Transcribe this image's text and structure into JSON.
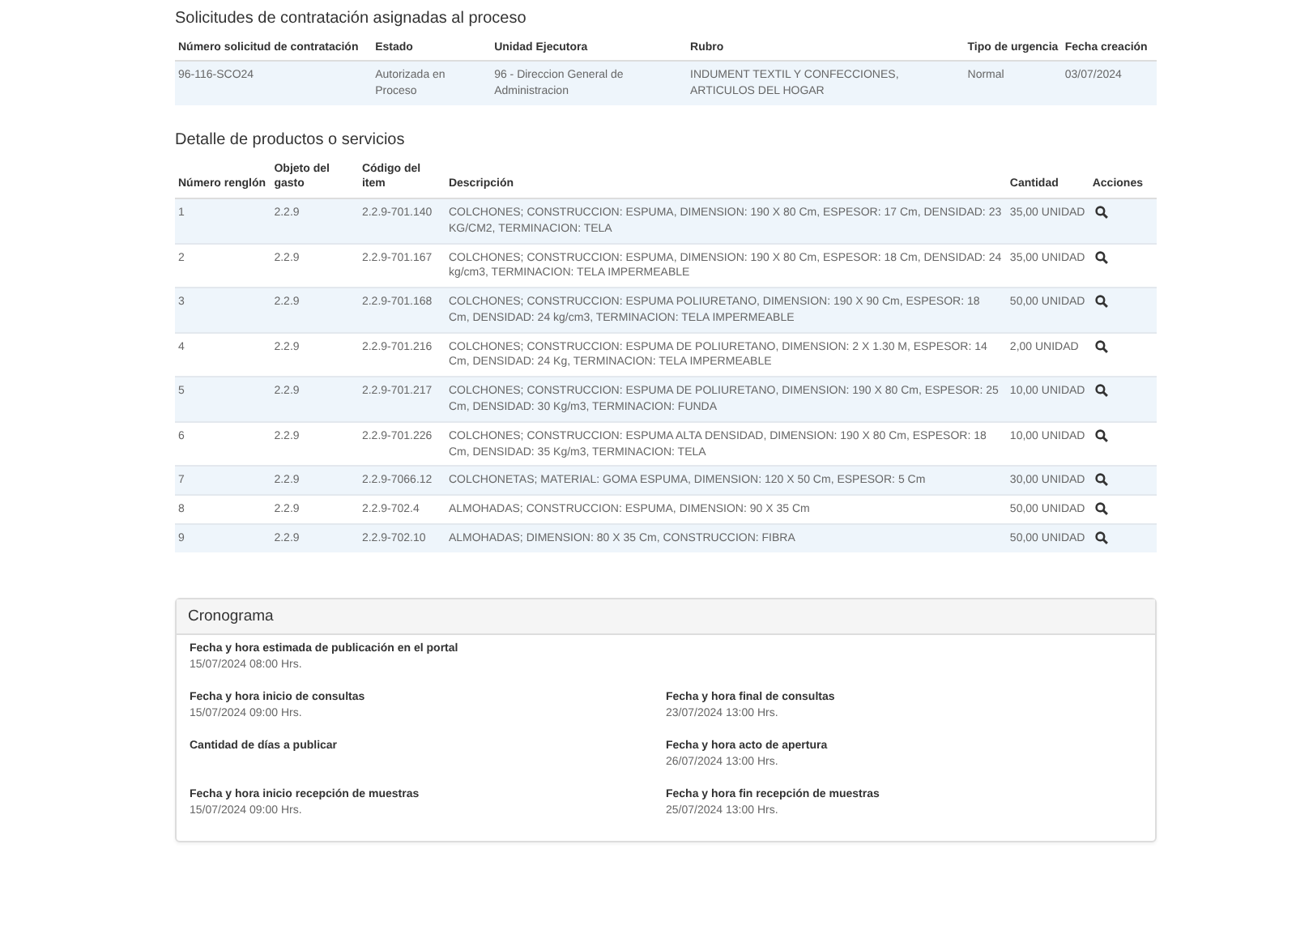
{
  "requests": {
    "title": "Solicitudes de contratación asignadas al proceso",
    "columns": [
      "Número solicitud de contratación",
      "Estado",
      "Unidad Ejecutora",
      "Rubro",
      "Tipo de urgencia",
      "Fecha creación"
    ],
    "rows": [
      [
        "96-116-SCO24",
        "Autorizada en Proceso",
        "96 - Direccion General de Administracion",
        "INDUMENT TEXTIL Y CONFECCIONES, ARTICULOS DEL HOGAR",
        "Normal",
        "03/07/2024"
      ]
    ]
  },
  "products": {
    "title": "Detalle de productos o servicios",
    "columns": [
      "Número renglón",
      "Objeto del gasto",
      "Código del item",
      "Descripción",
      "Cantidad",
      "Acciones"
    ],
    "rows": [
      {
        "cells": [
          "1",
          "2.2.9",
          "2.2.9-701.140",
          "COLCHONES; CONSTRUCCION: ESPUMA, DIMENSION: 190 X 80 Cm, ESPESOR: 17 Cm, DENSIDAD: 23 KG/CM2, TERMINACION: TELA",
          "35,00 UNIDAD"
        ]
      },
      {
        "cells": [
          "2",
          "2.2.9",
          "2.2.9-701.167",
          "COLCHONES; CONSTRUCCION: ESPUMA, DIMENSION: 190 X 80 Cm, ESPESOR: 18 Cm, DENSIDAD: 24 kg/cm3, TERMINACION: TELA IMPERMEABLE",
          "35,00 UNIDAD"
        ]
      },
      {
        "cells": [
          "3",
          "2.2.9",
          "2.2.9-701.168",
          "COLCHONES; CONSTRUCCION: ESPUMA POLIURETANO, DIMENSION: 190 X 90 Cm, ESPESOR: 18 Cm, DENSIDAD: 24 kg/cm3, TERMINACION: TELA IMPERMEABLE",
          "50,00 UNIDAD"
        ]
      },
      {
        "cells": [
          "4",
          "2.2.9",
          "2.2.9-701.216",
          "COLCHONES; CONSTRUCCION: ESPUMA DE POLIURETANO, DIMENSION: 2 X 1.30 M, ESPESOR: 14 Cm, DENSIDAD: 24 Kg, TERMINACION: TELA IMPERMEABLE",
          "2,00 UNIDAD"
        ]
      },
      {
        "cells": [
          "5",
          "2.2.9",
          "2.2.9-701.217",
          "COLCHONES; CONSTRUCCION: ESPUMA DE POLIURETANO, DIMENSION: 190 X 80 Cm, ESPESOR: 25 Cm, DENSIDAD: 30 Kg/m3, TERMINACION: FUNDA",
          "10,00 UNIDAD"
        ]
      },
      {
        "cells": [
          "6",
          "2.2.9",
          "2.2.9-701.226",
          "COLCHONES; CONSTRUCCION: ESPUMA ALTA DENSIDAD, DIMENSION: 190 X 80 Cm, ESPESOR: 18 Cm, DENSIDAD: 35 Kg/m3, TERMINACION: TELA",
          "10,00 UNIDAD"
        ]
      },
      {
        "cells": [
          "7",
          "2.2.9",
          "2.2.9-7066.12",
          "COLCHONETAS; MATERIAL: GOMA ESPUMA, DIMENSION: 120 X 50 Cm, ESPESOR: 5 Cm",
          "30,00 UNIDAD"
        ]
      },
      {
        "cells": [
          "8",
          "2.2.9",
          "2.2.9-702.4",
          "ALMOHADAS; CONSTRUCCION: ESPUMA, DIMENSION: 90 X 35 Cm",
          "50,00 UNIDAD"
        ]
      },
      {
        "cells": [
          "9",
          "2.2.9",
          "2.2.9-702.10",
          "ALMOHADAS; DIMENSION: 80 X 35 Cm, CONSTRUCCION: FIBRA",
          "50,00 UNIDAD"
        ]
      }
    ]
  },
  "schedule": {
    "title": "Cronograma",
    "fields": [
      {
        "kind": "wide",
        "label": "Fecha y hora estimada de publicación en el portal",
        "value": "15/07/2024 08:00 Hrs."
      },
      {
        "kind": "half",
        "label": "Fecha y hora inicio de consultas",
        "value": "15/07/2024 09:00 Hrs."
      },
      {
        "kind": "half",
        "label": "Fecha y hora final de consultas",
        "value": "23/07/2024 13:00 Hrs."
      },
      {
        "kind": "half",
        "label": "Cantidad de días a publicar"
      },
      {
        "kind": "half",
        "label": "Fecha y hora acto de apertura",
        "value": "26/07/2024 13:00 Hrs."
      },
      {
        "kind": "half",
        "label": "Fecha y hora inicio recepción de muestras",
        "value": "15/07/2024 09:00 Hrs."
      },
      {
        "kind": "half",
        "label": "Fecha y hora fin recepción de muestras",
        "value": "25/07/2024 13:00 Hrs."
      }
    ]
  }
}
